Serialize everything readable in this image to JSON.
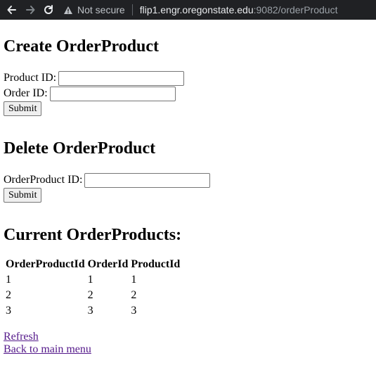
{
  "browser": {
    "security_label": "Not secure",
    "url_host": "flip1.engr.oregonstate.edu",
    "url_rest": ":9082/orderProduct"
  },
  "create_section": {
    "title": "Create OrderProduct",
    "product_id_label": "Product ID:",
    "product_id_value": "",
    "order_id_label": "Order ID:",
    "order_id_value": "",
    "submit_label": "Submit"
  },
  "delete_section": {
    "title": "Delete OrderProduct",
    "orderproduct_id_label": "OrderProduct ID:",
    "orderproduct_id_value": "",
    "submit_label": "Submit"
  },
  "current_section": {
    "title": "Current OrderProducts:",
    "columns": [
      "OrderProductId",
      "OrderId",
      "ProductId"
    ],
    "rows": [
      [
        "1",
        "1",
        "1"
      ],
      [
        "2",
        "2",
        "2"
      ],
      [
        "3",
        "3",
        "3"
      ]
    ]
  },
  "links": {
    "refresh": "Refresh",
    "back": "Back to main menu"
  },
  "icons": {
    "back": "arrow-left-icon",
    "forward": "arrow-right-icon",
    "reload": "reload-icon",
    "warning": "warning-triangle-icon"
  }
}
